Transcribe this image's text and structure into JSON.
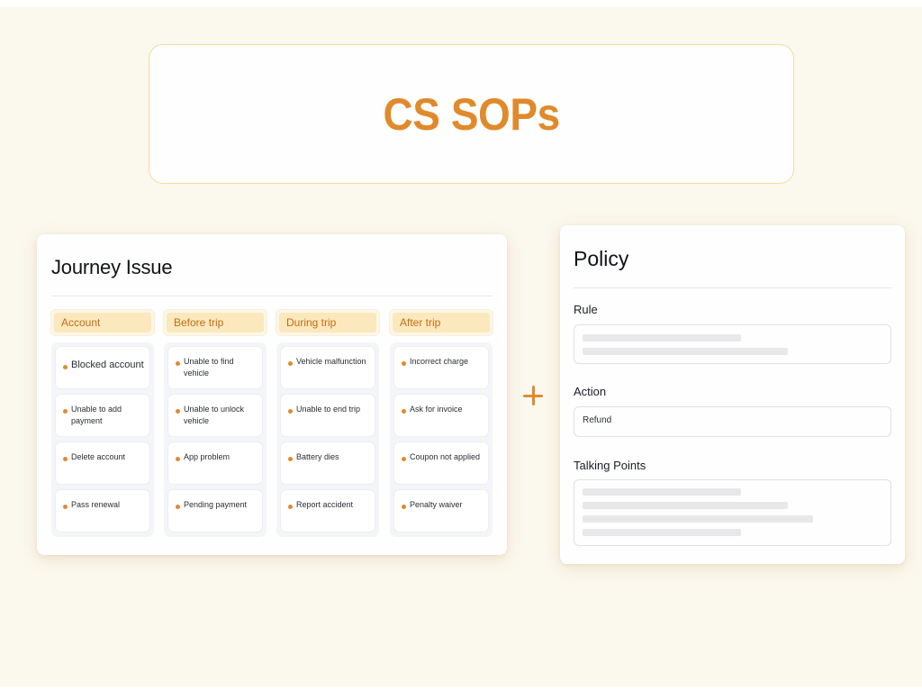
{
  "title": "CS SOPs",
  "journey": {
    "title": "Journey Issue",
    "columns": [
      {
        "header": "Account",
        "items": [
          {
            "label": "Blocked account"
          },
          {
            "label": "Unable to add payment"
          },
          {
            "label": "Delete account"
          },
          {
            "label": "Pass renewal"
          }
        ]
      },
      {
        "header": "Before trip",
        "items": [
          {
            "label": "Unable to find vehicle"
          },
          {
            "label": "Unable to unlock vehicle"
          },
          {
            "label": "App problem"
          },
          {
            "label": "Pending payment"
          }
        ]
      },
      {
        "header": "During trip",
        "items": [
          {
            "label": "Vehicle malfunction"
          },
          {
            "label": "Unable to end trip"
          },
          {
            "label": "Battery dies"
          },
          {
            "label": "Report accident"
          }
        ]
      },
      {
        "header": "After trip",
        "items": [
          {
            "label": "Incorrect charge"
          },
          {
            "label": "Ask for invoice"
          },
          {
            "label": "Coupon not applied"
          },
          {
            "label": "Penalty waiver"
          }
        ]
      }
    ]
  },
  "connector_icon": "plus-icon",
  "policy": {
    "title": "Policy",
    "rule": {
      "label": "Rule"
    },
    "action": {
      "label": "Action",
      "value": "Refund"
    },
    "talking_points": {
      "label": "Talking Points"
    }
  },
  "colors": {
    "accent": "#e08a2c",
    "background": "#fbf8ee",
    "header_fill": "#fbe9bd",
    "header_text": "#c56a18"
  }
}
